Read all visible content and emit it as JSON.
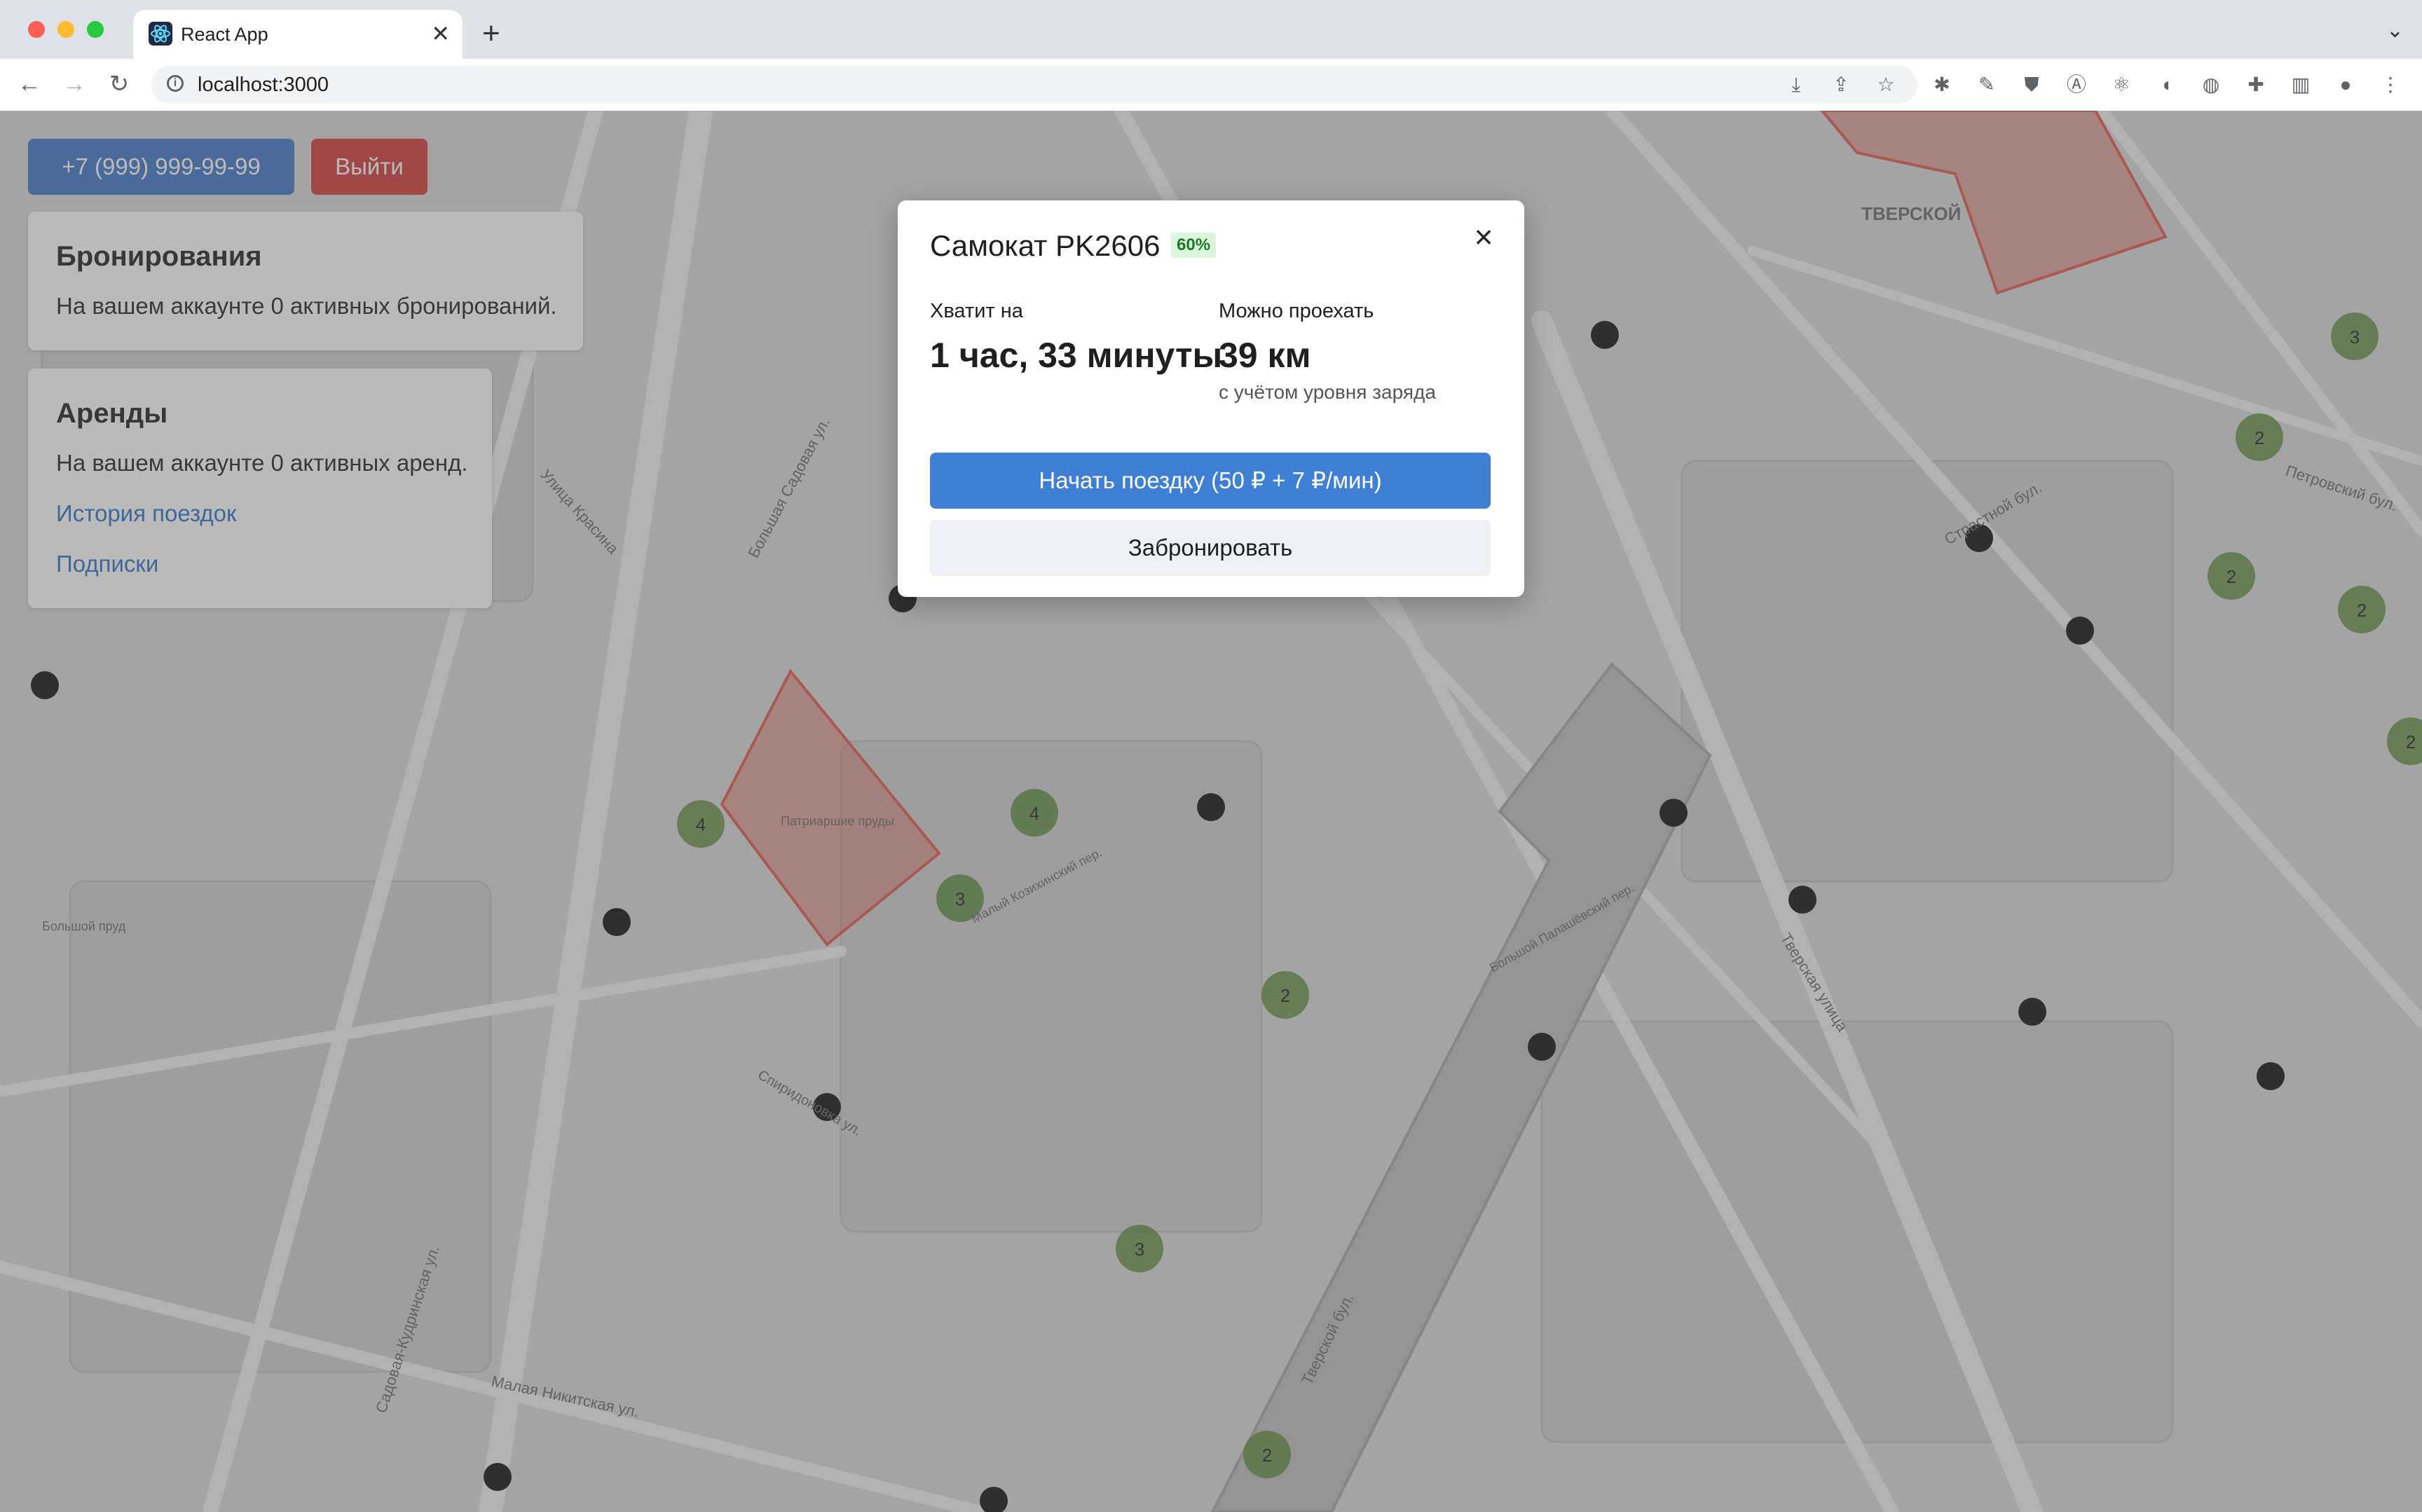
{
  "browser": {
    "tab_title": "React App",
    "tab_close": "✕",
    "new_tab": "+",
    "tab_menu": "⌄",
    "url": "localhost:3000",
    "nav": {
      "back": "←",
      "forward": "→",
      "reload": "↻"
    },
    "info_icon": "i",
    "extensions": [
      "download-icon",
      "share-icon",
      "star-icon",
      "bug-icon",
      "eyedropper-icon",
      "shield-icon",
      "translate-icon",
      "react-devtools-icon",
      "media-icon",
      "globe-icon",
      "puzzle-icon",
      "sidepanel-icon",
      "profile-icon",
      "menu-icon"
    ]
  },
  "header": {
    "phone_label": "+7 (999) 999-99-99",
    "logout_label": "Выйти"
  },
  "bookings_card": {
    "title": "Бронирования",
    "text": "На вашем аккаунте 0 активных бронирований."
  },
  "rentals_card": {
    "title": "Аренды",
    "text": "На вашем аккаунте 0 активных аренд.",
    "history_link": "История поездок",
    "subscriptions_link": "Подписки"
  },
  "modal": {
    "title": "Самокат PK2606",
    "battery_badge": "60%",
    "close_label": "×",
    "time_label": "Хватит на",
    "time_value": "1 час, 33 минуты",
    "distance_label": "Можно проехать",
    "distance_value": "39 км",
    "distance_hint": "с учётом уровня заряда",
    "start_button": "Начать поездку (50 ₽ + 7 ₽/мин)",
    "book_button": "Забронировать"
  },
  "map": {
    "area_labels": [
      "ТВЕРСКОЙ",
      "Патриаршие пруды",
      "Большой пруд"
    ],
    "street_labels": [
      "Большая Садовая ул.",
      "Садовая-Кудринская ул.",
      "Тверская улица",
      "Тверской бул.",
      "Страстной бул.",
      "Малая Никитская ул.",
      "Улица Красина",
      "Спиридоновка ул.",
      "Малый Козихинский пер.",
      "Большой Палашёвский пер.",
      "Петровский бул."
    ],
    "clusters": [
      "3",
      "2",
      "2",
      "2",
      "4",
      "4",
      "3",
      "2",
      "3",
      "2",
      "2"
    ],
    "colors": {
      "cluster": "#5a8a3c",
      "zone_red": "#e05a4c",
      "scooter_pin": "#111111"
    }
  }
}
